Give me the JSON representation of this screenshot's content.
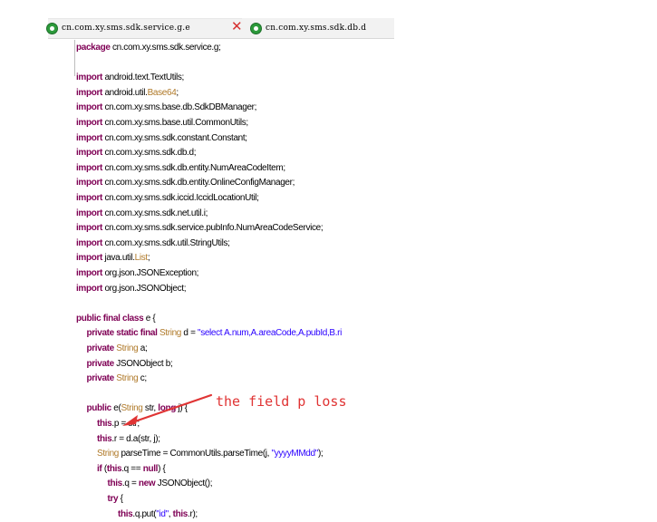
{
  "tabs": [
    {
      "label": "cn.com.xy.sms.sdk.service.g.e",
      "active": true,
      "icon": "class-icon",
      "closable": true
    },
    {
      "label": "cn.com.xy.sms.sdk.db.d",
      "active": false,
      "icon": "class-icon",
      "closable": false
    }
  ],
  "code_lines": [
    {
      "indent": 0,
      "tokens": [
        {
          "t": "package",
          "c": "kw"
        },
        {
          "t": " cn.com.xy.sms.sdk.service.g;",
          "c": "pl"
        }
      ]
    },
    {
      "indent": 0,
      "tokens": []
    },
    {
      "indent": 0,
      "tokens": [
        {
          "t": "import",
          "c": "kw"
        },
        {
          "t": " android.text.TextUtils;",
          "c": "pl"
        }
      ]
    },
    {
      "indent": 0,
      "tokens": [
        {
          "t": "import",
          "c": "kw"
        },
        {
          "t": " android.util.",
          "c": "pl"
        },
        {
          "t": "Base64",
          "c": "ty"
        },
        {
          "t": ";",
          "c": "pl"
        }
      ]
    },
    {
      "indent": 0,
      "tokens": [
        {
          "t": "import",
          "c": "kw"
        },
        {
          "t": " cn.com.xy.sms.base.db.SdkDBManager;",
          "c": "pl"
        }
      ]
    },
    {
      "indent": 0,
      "tokens": [
        {
          "t": "import",
          "c": "kw"
        },
        {
          "t": " cn.com.xy.sms.base.util.CommonUtils;",
          "c": "pl"
        }
      ]
    },
    {
      "indent": 0,
      "tokens": [
        {
          "t": "import",
          "c": "kw"
        },
        {
          "t": " cn.com.xy.sms.sdk.constant.Constant;",
          "c": "pl"
        }
      ]
    },
    {
      "indent": 0,
      "tokens": [
        {
          "t": "import",
          "c": "kw"
        },
        {
          "t": " cn.com.xy.sms.sdk.db.d;",
          "c": "pl"
        }
      ]
    },
    {
      "indent": 0,
      "tokens": [
        {
          "t": "import",
          "c": "kw"
        },
        {
          "t": " cn.com.xy.sms.sdk.db.entity.NumAreaCodeItem;",
          "c": "pl"
        }
      ]
    },
    {
      "indent": 0,
      "tokens": [
        {
          "t": "import",
          "c": "kw"
        },
        {
          "t": " cn.com.xy.sms.sdk.db.entity.OnlineConfigManager;",
          "c": "pl"
        }
      ]
    },
    {
      "indent": 0,
      "tokens": [
        {
          "t": "import",
          "c": "kw"
        },
        {
          "t": " cn.com.xy.sms.sdk.iccid.IccidLocationUtil;",
          "c": "pl"
        }
      ]
    },
    {
      "indent": 0,
      "tokens": [
        {
          "t": "import",
          "c": "kw"
        },
        {
          "t": " cn.com.xy.sms.sdk.net.util.i;",
          "c": "pl"
        }
      ]
    },
    {
      "indent": 0,
      "tokens": [
        {
          "t": "import",
          "c": "kw"
        },
        {
          "t": " cn.com.xy.sms.sdk.service.pubInfo.NumAreaCodeService;",
          "c": "pl"
        }
      ]
    },
    {
      "indent": 0,
      "tokens": [
        {
          "t": "import",
          "c": "kw"
        },
        {
          "t": " cn.com.xy.sms.sdk.util.StringUtils;",
          "c": "pl"
        }
      ]
    },
    {
      "indent": 0,
      "tokens": [
        {
          "t": "import",
          "c": "kw"
        },
        {
          "t": " java.util.",
          "c": "pl"
        },
        {
          "t": "List",
          "c": "ty"
        },
        {
          "t": ";",
          "c": "pl"
        }
      ]
    },
    {
      "indent": 0,
      "tokens": [
        {
          "t": "import",
          "c": "kw"
        },
        {
          "t": " org.json.JSONException;",
          "c": "pl"
        }
      ]
    },
    {
      "indent": 0,
      "tokens": [
        {
          "t": "import",
          "c": "kw"
        },
        {
          "t": " org.json.JSONObject;",
          "c": "pl"
        }
      ]
    },
    {
      "indent": 0,
      "tokens": []
    },
    {
      "indent": 0,
      "tokens": [
        {
          "t": "public final class",
          "c": "kw"
        },
        {
          "t": " e {",
          "c": "pl"
        }
      ]
    },
    {
      "indent": 1,
      "tokens": [
        {
          "t": "private static final",
          "c": "kw"
        },
        {
          "t": " ",
          "c": "pl"
        },
        {
          "t": "String",
          "c": "ty"
        },
        {
          "t": " d = ",
          "c": "pl"
        },
        {
          "t": "\"select A.num,A.areaCode,A.pubId,B.ri",
          "c": "st"
        }
      ]
    },
    {
      "indent": 1,
      "tokens": [
        {
          "t": "private",
          "c": "kw"
        },
        {
          "t": " ",
          "c": "pl"
        },
        {
          "t": "String",
          "c": "ty"
        },
        {
          "t": " a;",
          "c": "pl"
        }
      ]
    },
    {
      "indent": 1,
      "tokens": [
        {
          "t": "private",
          "c": "kw"
        },
        {
          "t": " JSONObject b;",
          "c": "pl"
        }
      ]
    },
    {
      "indent": 1,
      "tokens": [
        {
          "t": "private",
          "c": "kw"
        },
        {
          "t": " ",
          "c": "pl"
        },
        {
          "t": "String",
          "c": "ty"
        },
        {
          "t": " c;",
          "c": "pl"
        }
      ]
    },
    {
      "indent": 0,
      "tokens": []
    },
    {
      "indent": 1,
      "tokens": [
        {
          "t": "public",
          "c": "kw"
        },
        {
          "t": " e(",
          "c": "pl"
        },
        {
          "t": "String",
          "c": "ty"
        },
        {
          "t": " str, ",
          "c": "pl"
        },
        {
          "t": "long",
          "c": "kw"
        },
        {
          "t": " j) {",
          "c": "pl"
        }
      ]
    },
    {
      "indent": 2,
      "tokens": [
        {
          "t": "this",
          "c": "kw"
        },
        {
          "t": ".p = str;",
          "c": "pl"
        }
      ]
    },
    {
      "indent": 2,
      "tokens": [
        {
          "t": "this",
          "c": "kw"
        },
        {
          "t": ".r = d.a(str, j);",
          "c": "pl"
        }
      ]
    },
    {
      "indent": 2,
      "tokens": [
        {
          "t": "String",
          "c": "ty"
        },
        {
          "t": " parseTime = CommonUtils.parseTime(j, ",
          "c": "pl"
        },
        {
          "t": "\"yyyyMMdd\"",
          "c": "st"
        },
        {
          "t": ");",
          "c": "pl"
        }
      ]
    },
    {
      "indent": 2,
      "tokens": [
        {
          "t": "if",
          "c": "kw"
        },
        {
          "t": " (",
          "c": "pl"
        },
        {
          "t": "this",
          "c": "kw"
        },
        {
          "t": ".q == ",
          "c": "pl"
        },
        {
          "t": "null",
          "c": "kw"
        },
        {
          "t": ") {",
          "c": "pl"
        }
      ]
    },
    {
      "indent": 3,
      "tokens": [
        {
          "t": "this",
          "c": "kw"
        },
        {
          "t": ".q = ",
          "c": "pl"
        },
        {
          "t": "new",
          "c": "kw"
        },
        {
          "t": " JSONObject();",
          "c": "pl"
        }
      ]
    },
    {
      "indent": 3,
      "tokens": [
        {
          "t": "try",
          "c": "kw"
        },
        {
          "t": " {",
          "c": "pl"
        }
      ]
    },
    {
      "indent": 4,
      "tokens": [
        {
          "t": "this",
          "c": "kw"
        },
        {
          "t": ".q.put(",
          "c": "pl"
        },
        {
          "t": "\"id\"",
          "c": "st"
        },
        {
          "t": ", ",
          "c": "pl"
        },
        {
          "t": "this",
          "c": "kw"
        },
        {
          "t": ".r);",
          "c": "pl"
        }
      ]
    }
  ],
  "annotation": {
    "text": "the field p loss"
  },
  "colors": {
    "keyword": "#7f0055",
    "type": "#b07a2a",
    "string": "#2a00ff",
    "annotation": "#e03434"
  }
}
